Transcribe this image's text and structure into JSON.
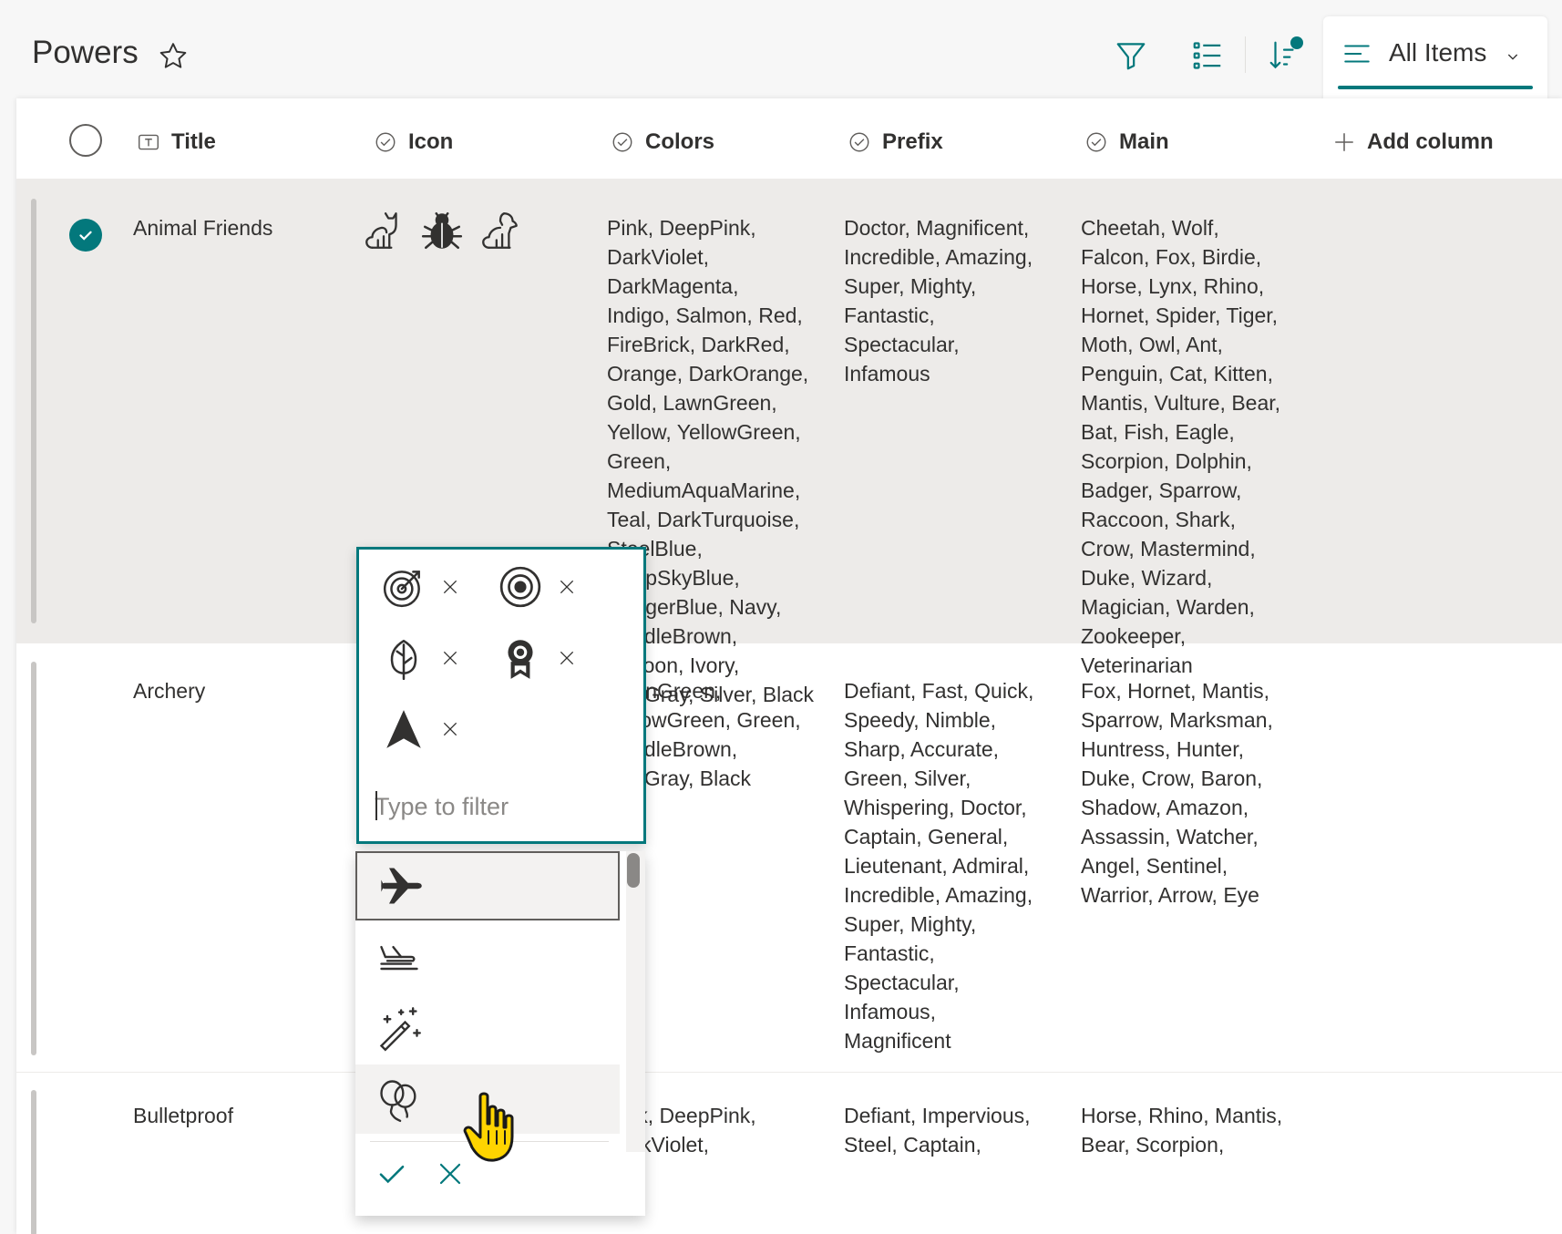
{
  "header": {
    "title": "Powers",
    "view_label": "All Items"
  },
  "columns": {
    "title": "Title",
    "icon": "Icon",
    "colors": "Colors",
    "prefix": "Prefix",
    "main": "Main",
    "add": "Add column"
  },
  "rows": [
    {
      "title": "Animal Friends",
      "selected": true,
      "icons": [
        "cat-icon",
        "bug-icon",
        "dog-icon"
      ],
      "colors": [
        "Pink, DeepPink,",
        "DarkViolet,",
        "DarkMagenta,",
        "Indigo, Salmon, Red,",
        "FireBrick, DarkRed,",
        "Orange, DarkOrange,",
        "Gold, LawnGreen,",
        "Yellow, YellowGreen,",
        "Green,",
        "MediumAquaMarine,",
        "Teal, DarkTurquoise,",
        "SteelBlue,",
        "DeepSkyBlue,",
        "DodgerBlue, Navy,",
        "SaddleBrown,",
        "Maroon, Ivory,",
        "DimGray, Silver, Black"
      ],
      "prefix": [
        "Doctor, Magnificent,",
        "Incredible, Amazing,",
        "Super, Mighty,",
        "Fantastic,",
        "Spectacular,",
        "Infamous"
      ],
      "main": [
        "Cheetah, Wolf,",
        "Falcon, Fox, Birdie,",
        "Horse, Lynx, Rhino,",
        "Hornet, Spider, Tiger,",
        "Moth, Owl, Ant,",
        "Penguin, Cat, Kitten,",
        "Mantis, Vulture, Bear,",
        "Bat, Fish, Eagle,",
        "Scorpion, Dolphin,",
        "Badger, Sparrow,",
        "Raccoon, Shark,",
        "Crow, Mastermind,",
        "Duke, Wizard,",
        "Magician, Warden,",
        "Zookeeper,",
        "Veterinarian"
      ]
    },
    {
      "title": "Archery",
      "selected": false,
      "colors": [
        "LawnGreen,",
        "YellowGreen, Green,",
        "SaddleBrown,",
        "DimGray, Black"
      ],
      "prefix": [
        "Defiant, Fast, Quick,",
        "Speedy, Nimble,",
        "Sharp, Accurate,",
        "Green, Silver,",
        "Whispering, Doctor,",
        "Captain, General,",
        "Lieutenant, Admiral,",
        "Incredible, Amazing,",
        "Super, Mighty,",
        "Fantastic,",
        "Spectacular,",
        "Infamous,",
        "Magnificent"
      ],
      "main": [
        "Fox, Hornet, Mantis,",
        "Sparrow, Marksman,",
        "Huntress, Hunter,",
        "Duke, Crow, Baron,",
        "Shadow, Amazon,",
        "Assassin, Watcher,",
        "Angel, Sentinel,",
        "Warrior, Arrow, Eye"
      ]
    },
    {
      "title": "Bulletproof",
      "selected": false,
      "colors": [
        "Pink, DeepPink,",
        "DarkViolet,"
      ],
      "prefix": [
        "Defiant, Impervious,",
        "Steel, Captain,"
      ],
      "main": [
        "Horse, Rhino, Mantis,",
        "Bear, Scorpion,"
      ]
    }
  ],
  "picker": {
    "selected_icons": [
      "bullseye-arrow-icon",
      "target-icon",
      "leaf-icon",
      "ribbon-award-icon",
      "navigation-arrow-icon"
    ],
    "filter_placeholder": "Type to filter",
    "options": [
      "airplane-icon",
      "airplane-landing-icon",
      "magic-wand-icon",
      "balloons-icon"
    ]
  },
  "colors": {
    "accent": "#03787c",
    "selected_row": "#edebe9",
    "text": "#323130"
  }
}
